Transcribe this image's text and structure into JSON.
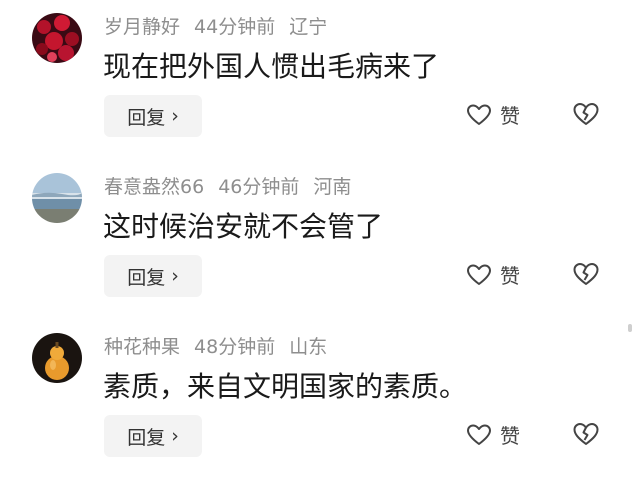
{
  "comments": [
    {
      "username": "岁月静好",
      "time": "44分钟前",
      "location": "辽宁",
      "text": "现在把外国人惯出毛病来了",
      "reply_label": "回复",
      "like_label": "赞",
      "avatar": "red-flowers-avatar"
    },
    {
      "username": "春意盎然66",
      "time": "46分钟前",
      "location": "河南",
      "text": "这时候治安就不会管了",
      "reply_label": "回复",
      "like_label": "赞",
      "avatar": "sea-landscape-avatar"
    },
    {
      "username": "种花种果",
      "time": "48分钟前",
      "location": "山东",
      "text": "素质，来自文明国家的素质。",
      "reply_label": "回复",
      "like_label": "赞",
      "avatar": "gourd-avatar"
    }
  ],
  "icons": {
    "reply_chevron": "chevron-right-icon",
    "like": "heart-icon",
    "dislike": "broken-heart-icon"
  }
}
